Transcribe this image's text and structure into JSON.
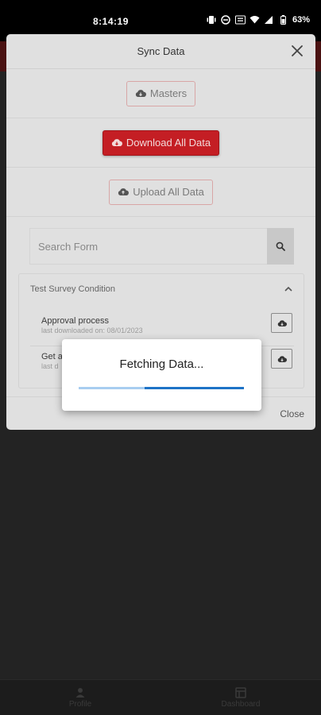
{
  "status_bar": {
    "time": "8:14:19",
    "battery": "63%"
  },
  "background": {
    "nav": [
      {
        "label": "Profile",
        "icon": "person-icon"
      },
      {
        "label": "Dashboard",
        "icon": "grid-icon"
      }
    ]
  },
  "modal": {
    "title": "Sync Data",
    "buttons": {
      "masters": "Masters",
      "download_all": "Download All Data",
      "upload_all": "Upload All Data"
    },
    "search": {
      "placeholder": "Search Form"
    },
    "section": {
      "title": "Test Survey Condition",
      "items": [
        {
          "name": "Approval process",
          "sub": "last downloaded on: 08/01/2023"
        },
        {
          "name": "Get a",
          "sub": "last d"
        }
      ]
    },
    "footer_close": "Close"
  },
  "loading": {
    "message": "Fetching Data...",
    "progress": 0.4
  },
  "colors": {
    "primary": "#c41e24",
    "progress_fill": "#1e73c7",
    "progress_track": "#a8cdf0"
  }
}
